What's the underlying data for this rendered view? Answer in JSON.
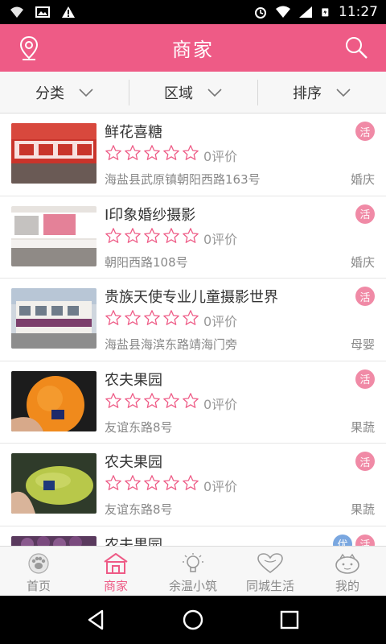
{
  "status_bar": {
    "time": "11:27"
  },
  "header": {
    "title": "商家"
  },
  "filters": [
    {
      "label": "分类"
    },
    {
      "label": "区域"
    },
    {
      "label": "排序"
    }
  ],
  "merchants": [
    {
      "name": "鲜花喜糖",
      "reviews": "0评价",
      "address": "海盐县武原镇朝阳西路163号",
      "category": "婚庆",
      "badge": "活",
      "rating": 0
    },
    {
      "name": "I印象婚纱摄影",
      "reviews": "0评价",
      "address": "朝阳西路108号",
      "category": "婚庆",
      "badge": "活",
      "rating": 0
    },
    {
      "name": "贵族天使专业儿童摄影世界",
      "reviews": "0评价",
      "address": "海盐县海滨东路靖海门旁",
      "category": "母婴",
      "badge": "活",
      "rating": 0
    },
    {
      "name": "农夫果园",
      "reviews": "0评价",
      "address": "友谊东路8号",
      "category": "果蔬",
      "badge": "活",
      "rating": 0
    },
    {
      "name": "农夫果园",
      "reviews": "0评价",
      "address": "友谊东路8号",
      "category": "果蔬",
      "badge": "活",
      "rating": 0
    },
    {
      "name": "农夫果园",
      "reviews": "",
      "address": "",
      "category": "",
      "badge": "活",
      "badge2": "优",
      "rating": 0
    }
  ],
  "tabs": [
    {
      "label": "首页",
      "icon": "paw-icon"
    },
    {
      "label": "商家",
      "icon": "shop-icon",
      "active": true
    },
    {
      "label": "余温小筑",
      "icon": "bulb-icon"
    },
    {
      "label": "同城生活",
      "icon": "heart-icon"
    },
    {
      "label": "我的",
      "icon": "face-icon"
    }
  ],
  "colors": {
    "accent": "#ee5b86",
    "badge": "#f08aa6"
  }
}
